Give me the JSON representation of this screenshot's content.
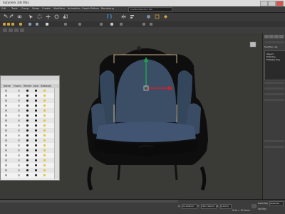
{
  "titlebar": {
    "title": "Autodesk 3ds Max"
  },
  "menubar": {
    "items": [
      "Edit",
      "Tools",
      "Group",
      "Views",
      "Create",
      "Modifiers",
      "Animation",
      "Graph Editors",
      "Rendering"
    ],
    "selection_set_placeholder": "Create Selection Set"
  },
  "viewport": {
    "label": "[+] [Perspective] [Realistic]",
    "colors": {
      "background": "#3a3a37",
      "upholstery": "#3c4e66",
      "frame": "#0d0d0d",
      "gizmo_y": "#1fa34a",
      "gizmo_x": "#d0202a"
    }
  },
  "explorer": {
    "columns": [
      "Name",
      "Frozen",
      "Render",
      "Color",
      "Radiosity"
    ],
    "row_count": 18
  },
  "cmdpanel": {
    "modifier_list_label": "Modifier List",
    "stack_items": [
      "Object",
      "Edit Poly",
      "Editable Poly"
    ]
  },
  "statusbar": {
    "x_label": "X:",
    "x_value": "21.109mm",
    "y_label": "Y:",
    "y_value": "762.704mm",
    "z_label": "Z:",
    "z_value": "0.0mm",
    "grid_label": "Grid = 10.0mm",
    "autokey_label": "Auto Key",
    "selected_label": "Selected",
    "setkey_label": "Set Key"
  }
}
